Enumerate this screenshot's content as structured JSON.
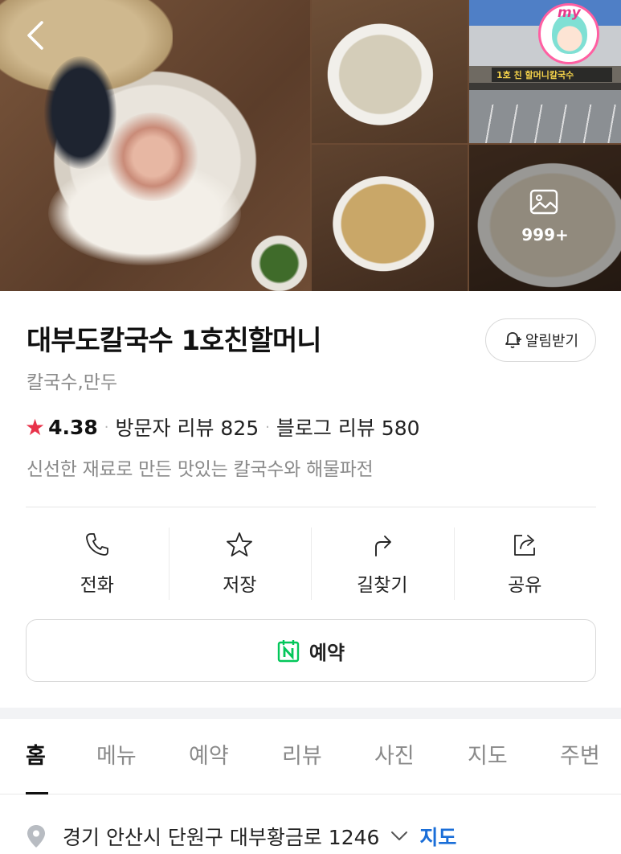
{
  "gallery": {
    "photo_count_label": "999+",
    "store_sign": "1호 친 할머니칼국수",
    "badge_text": "my"
  },
  "place": {
    "name": "대부도칼국수 1호친할머니",
    "category": "칼국수,만두",
    "rating": "4.38",
    "visitor_reviews": "방문자 리뷰 825",
    "blog_reviews": "블로그 리뷰 580",
    "description": "신선한 재료로 만든 맛있는 칼국수와 해물파전",
    "notify_label": "알림받기"
  },
  "actions": [
    {
      "label": "전화",
      "icon": "phone-icon"
    },
    {
      "label": "저장",
      "icon": "star-icon"
    },
    {
      "label": "길찾기",
      "icon": "directions-icon"
    },
    {
      "label": "공유",
      "icon": "share-icon"
    }
  ],
  "reserve": {
    "label": "예약",
    "icon": "naver-booking-icon"
  },
  "tabs": [
    {
      "label": "홈",
      "active": true
    },
    {
      "label": "메뉴"
    },
    {
      "label": "예약"
    },
    {
      "label": "리뷰"
    },
    {
      "label": "사진"
    },
    {
      "label": "지도"
    },
    {
      "label": "주변"
    }
  ],
  "address": {
    "text": "경기 안산시 단원구 대부황금로 1246",
    "map_link": "지도"
  },
  "colors": {
    "star": "#e8324a",
    "naver_green": "#03c75a",
    "link_blue": "#1a6ed8"
  }
}
